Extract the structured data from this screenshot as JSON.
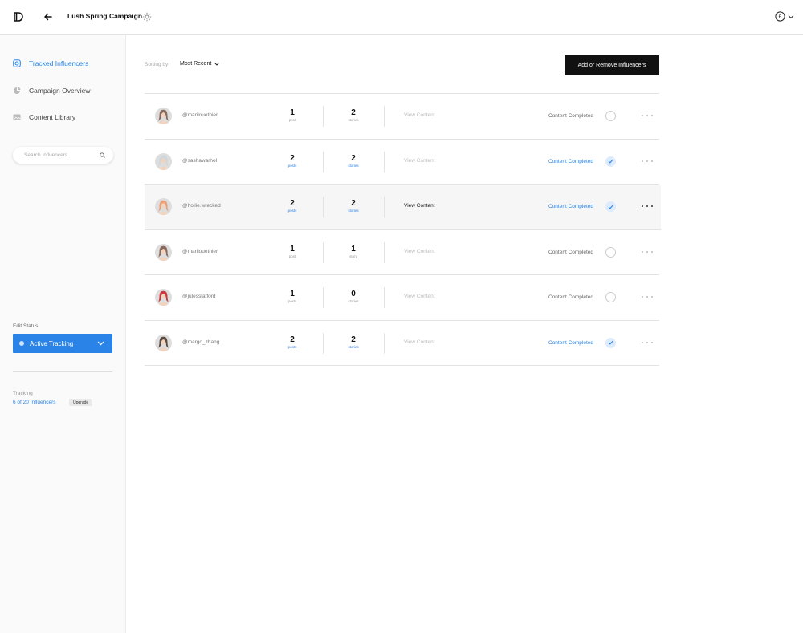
{
  "header": {
    "title": "Lush Spring Campaign"
  },
  "sidebar": {
    "items": [
      {
        "label": "Tracked Influencers",
        "icon": "instagram-icon",
        "active": true
      },
      {
        "label": "Campaign Overview",
        "icon": "pie-chart-icon",
        "active": false
      },
      {
        "label": "Content Library",
        "icon": "image-icon",
        "active": false
      }
    ],
    "search_placeholder": "Search Influencers",
    "edit_status_label": "Edit Status",
    "status_value": "Active Tracking",
    "tracking_label": "Tracking",
    "tracking_count": "6 of 20 Influencers",
    "upgrade_label": "Upgrade"
  },
  "main": {
    "sort_label": "Sorting by",
    "sort_value": "Most Recent",
    "add_button": "Add or Remove Influencers",
    "rows": [
      {
        "handle": "@marilouethier",
        "posts": "1",
        "posts_unit": "post",
        "stories": "2",
        "stories_unit": "stories",
        "view": "View Content",
        "completed_label": "Content Completed",
        "completed": false,
        "active": false,
        "avatar_color": "#8a6a5c"
      },
      {
        "handle": "@sashawarhol",
        "posts": "2",
        "posts_unit": "posts",
        "stories": "2",
        "stories_unit": "stories",
        "view": "View Content",
        "completed_label": "Content Completed",
        "completed": true,
        "active": false,
        "avatar_color": "#cfd6dc"
      },
      {
        "handle": "@hollie.wrecked",
        "posts": "2",
        "posts_unit": "posts",
        "stories": "2",
        "stories_unit": "stories",
        "view": "View Content",
        "completed_label": "Content Completed",
        "completed": true,
        "active": true,
        "avatar_color": "#e8a07a"
      },
      {
        "handle": "@marilouethier",
        "posts": "1",
        "posts_unit": "post",
        "stories": "1",
        "stories_unit": "story",
        "view": "View Content",
        "completed_label": "Content Completed",
        "completed": false,
        "active": false,
        "avatar_color": "#8a6a5c"
      },
      {
        "handle": "@julesstafford",
        "posts": "1",
        "posts_unit": "posts",
        "stories": "0",
        "stories_unit": "stories",
        "view": "View Content",
        "completed_label": "Content Completed",
        "completed": false,
        "active": false,
        "avatar_color": "#c9393f"
      },
      {
        "handle": "@margo_zhang",
        "posts": "2",
        "posts_unit": "posts",
        "stories": "2",
        "stories_unit": "stories",
        "view": "View Content",
        "completed_label": "Content Completed",
        "completed": true,
        "active": false,
        "avatar_color": "#5a4a40"
      }
    ]
  },
  "colors": {
    "accent": "#2a84e8",
    "button_dark": "#111111"
  }
}
